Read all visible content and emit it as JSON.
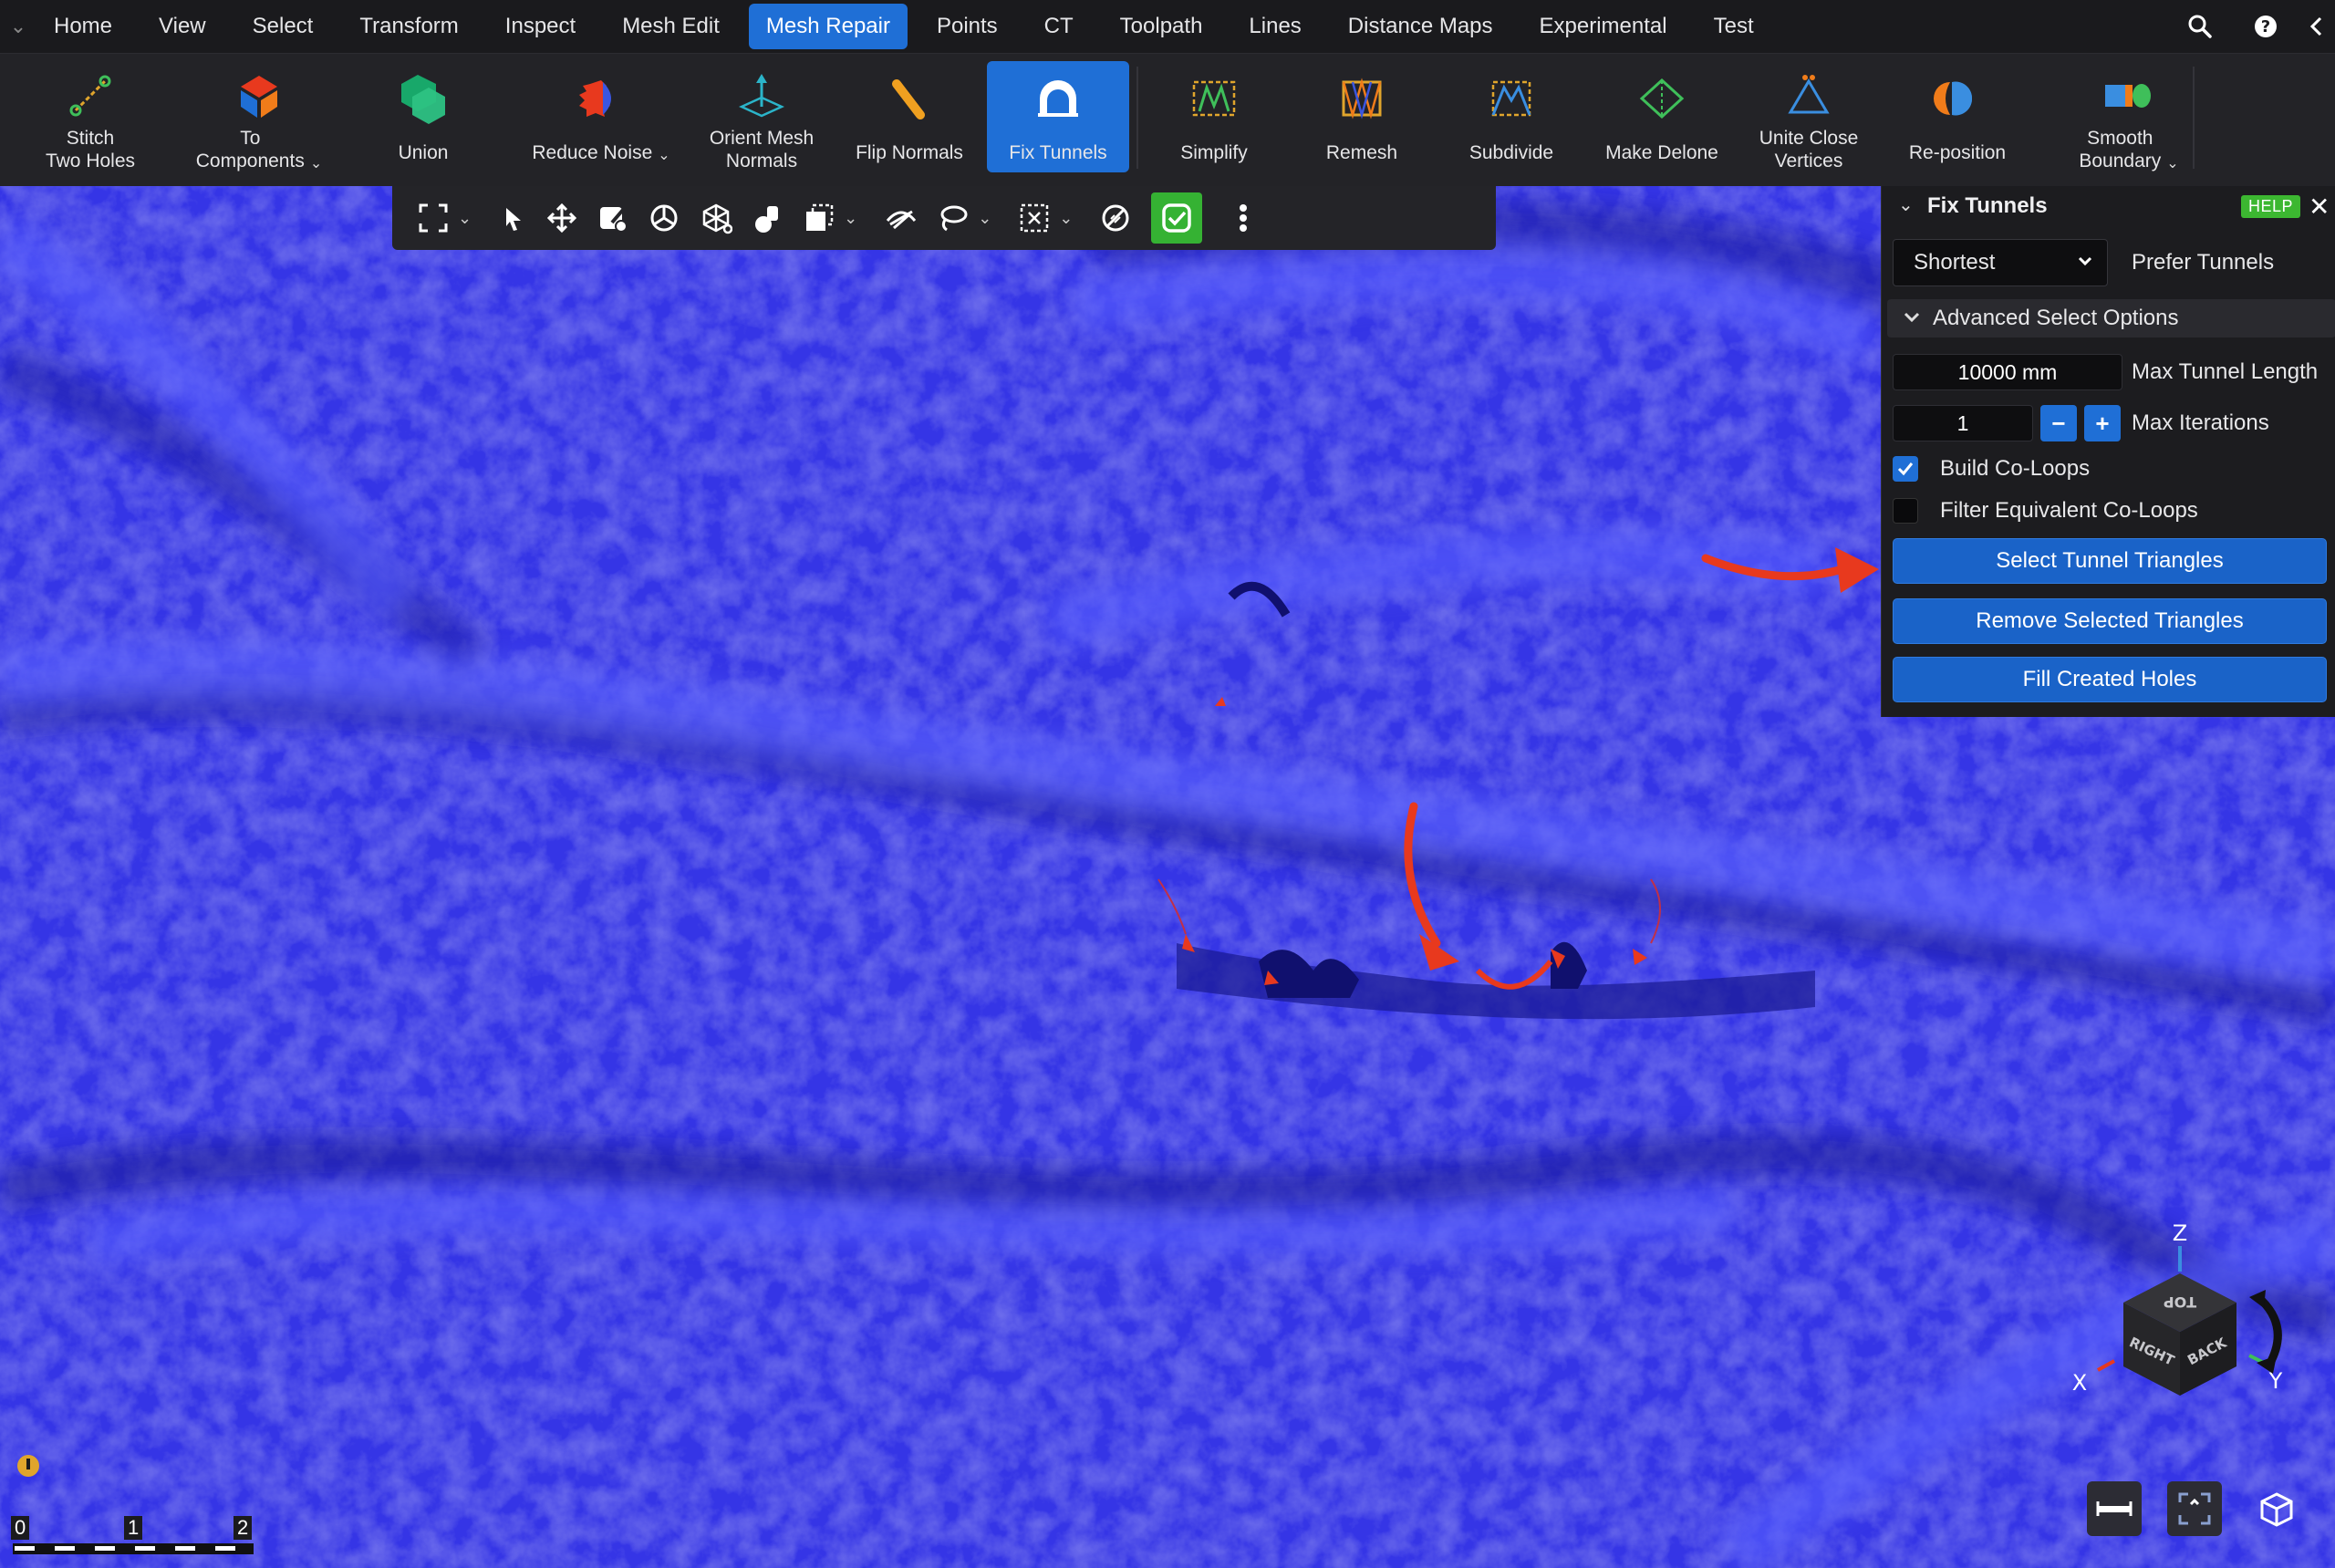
{
  "menubar": {
    "items": [
      "Home",
      "View",
      "Select",
      "Transform",
      "Inspect",
      "Mesh Edit",
      "Mesh Repair",
      "Points",
      "CT",
      "Toolpath",
      "Lines",
      "Distance Maps",
      "Experimental",
      "Test"
    ],
    "active": "Mesh Repair"
  },
  "ribbon": {
    "tools": [
      {
        "label": "Stitch\nTwo Holes",
        "icon": "stitch-holes-icon"
      },
      {
        "label": "To\nComponents",
        "icon": "components-icon",
        "dropdown": true
      },
      {
        "label": "Union",
        "icon": "union-icon"
      },
      {
        "label": "Reduce Noise",
        "icon": "reduce-noise-icon",
        "dropdown": true
      },
      {
        "label": "Orient Mesh\nNormals",
        "icon": "orient-normals-icon"
      },
      {
        "label": "Flip Normals",
        "icon": "flip-normals-icon"
      },
      {
        "label": "Fix Tunnels",
        "icon": "fix-tunnels-icon",
        "active": true
      },
      {
        "label": "Simplify",
        "icon": "simplify-icon"
      },
      {
        "label": "Remesh",
        "icon": "remesh-icon"
      },
      {
        "label": "Subdivide",
        "icon": "subdivide-icon"
      },
      {
        "label": "Make Delone",
        "icon": "make-delone-icon"
      },
      {
        "label": "Unite Close\nVertices",
        "icon": "unite-vertices-icon"
      },
      {
        "label": "Re-position",
        "icon": "reposition-icon"
      },
      {
        "label": "Smooth\nBoundary",
        "icon": "smooth-boundary-icon",
        "dropdown": true
      }
    ]
  },
  "panel": {
    "title": "Fix Tunnels",
    "help": "HELP",
    "mode_value": "Shortest",
    "mode_label": "Prefer Tunnels",
    "advanced_label": "Advanced Select Options",
    "max_length_value": "10000 mm",
    "max_length_label": "Max Tunnel Length",
    "max_iterations_value": "1",
    "max_iterations_label": "Max Iterations",
    "build_coloops_label": "Build Co-Loops",
    "build_coloops_checked": true,
    "filter_coloops_label": "Filter Equivalent Co-Loops",
    "filter_coloops_checked": false,
    "buttons": {
      "select": "Select Tunnel Triangles",
      "remove": "Remove Selected Triangles",
      "fill": "Fill Created Holes"
    }
  },
  "cube": {
    "top": "TOP",
    "right": "RIGHT",
    "back": "BACK",
    "axis_x": "X",
    "axis_y": "Y",
    "axis_z": "Z"
  },
  "scalebar": {
    "ticks": [
      "0",
      "1",
      "2"
    ]
  },
  "colors": {
    "accent": "#1f6fd6",
    "mesh": "#3535e6",
    "highlight": "#e8391e",
    "help": "#3cb731"
  }
}
